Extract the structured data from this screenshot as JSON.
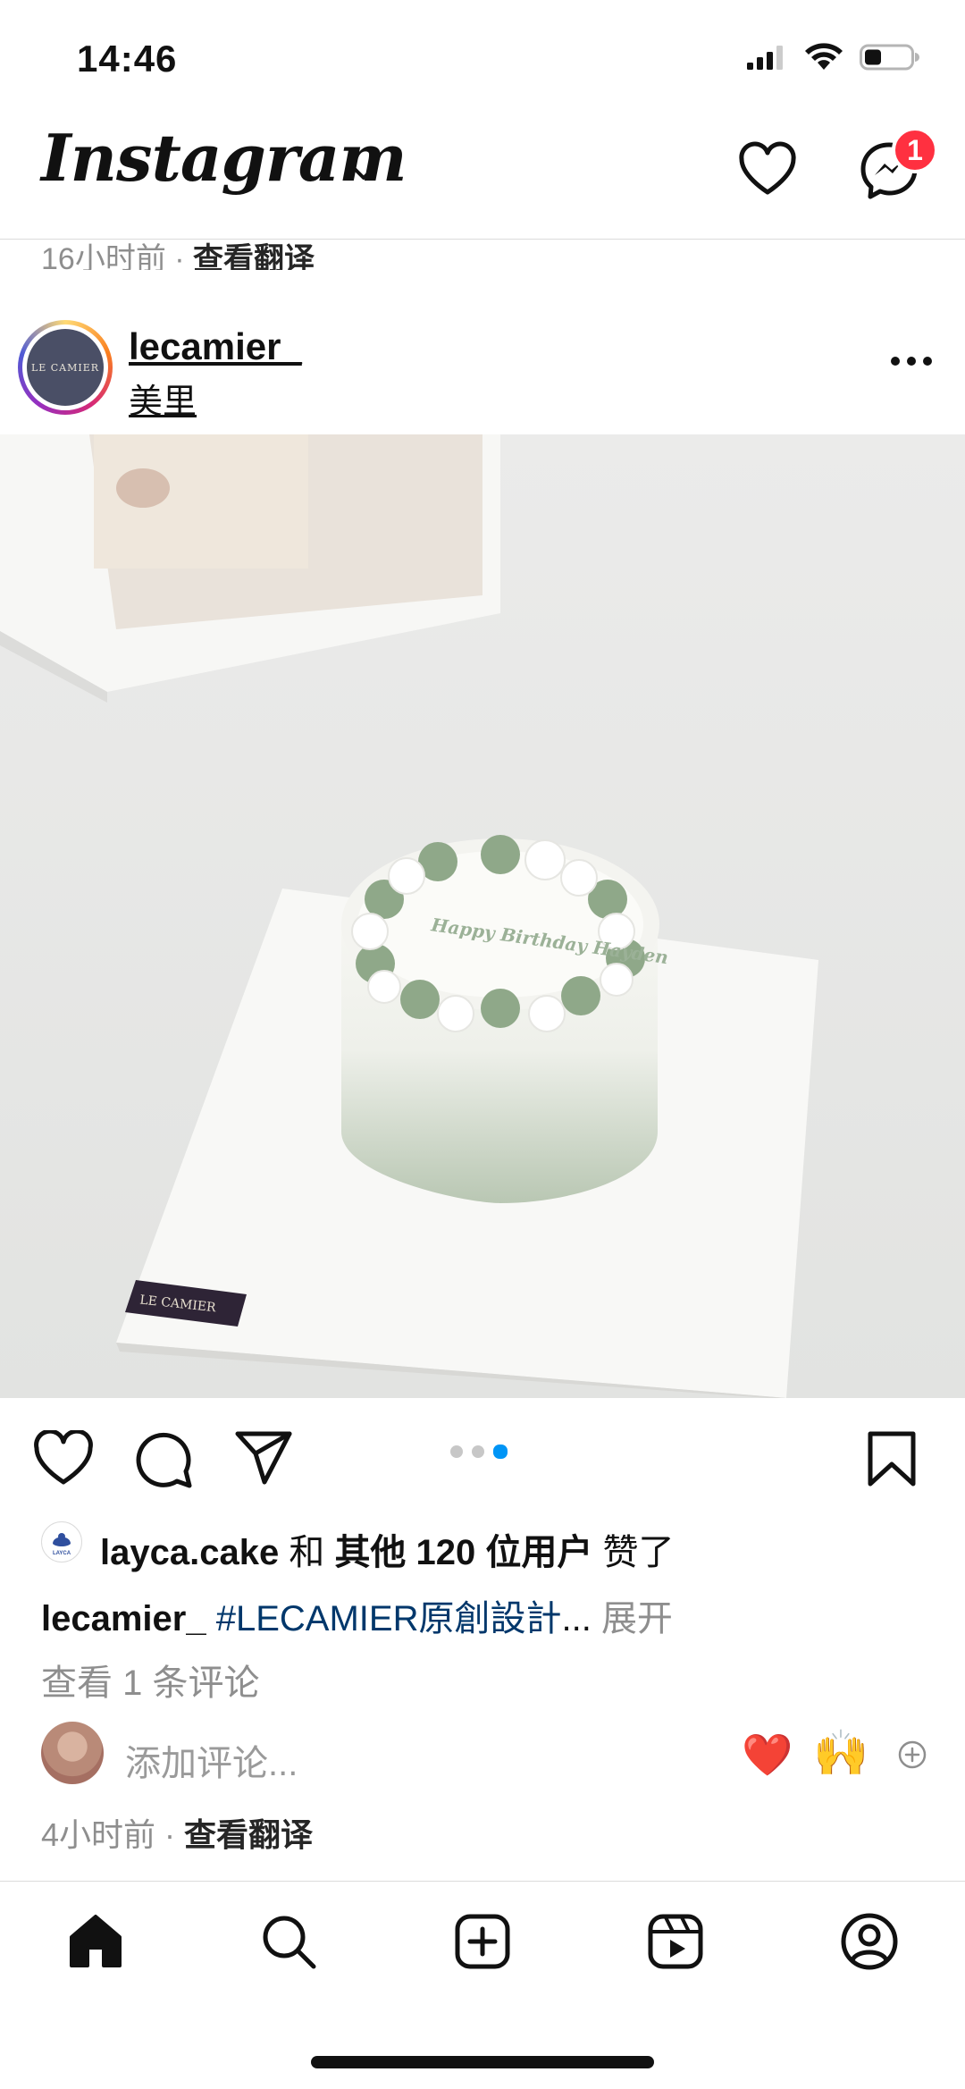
{
  "status_bar": {
    "time": "14:46",
    "icons": [
      "cellular-signal-icon",
      "wifi-icon",
      "battery-icon"
    ]
  },
  "top_nav": {
    "logo": "Instagram",
    "notification_badge": "1",
    "icons": [
      "chevron-down-icon",
      "heart-icon",
      "messenger-icon"
    ]
  },
  "previous_post": {
    "time_ago": "16小时前",
    "separator": " · ",
    "translate": "查看翻译"
  },
  "post": {
    "username": "lecamier_",
    "location": "美里",
    "avatar_text": "LE CAMIER",
    "image_brand_card": "LE CAMIER",
    "image_cake_text": "Happy Birthday Hayden",
    "carousel": {
      "count": 3,
      "active": 3
    },
    "likes": {
      "liker": "layca.cake",
      "connector": " 和 ",
      "others": "其他 120 位用户",
      "suffix": " 赞了",
      "liker_avatar_text": "LAYCA"
    },
    "caption": {
      "username": "lecamier_",
      "hashtag": "#LECAMIER原創設計",
      "ellipsis": "...",
      "expand": "展开"
    },
    "view_comments": "查看 1 条评论",
    "add_comment_placeholder": "添加评论...",
    "quick_emojis": [
      "❤️",
      "🙌"
    ],
    "time_ago": "4小时前",
    "separator": " · ",
    "translate": "查看翻译"
  },
  "tab_bar": {
    "tabs": [
      "home-icon",
      "search-icon",
      "create-icon",
      "reels-icon",
      "profile-icon"
    ]
  },
  "colors": {
    "accent_blue": "#0095f6",
    "badge_red": "#ff3040",
    "hashtag": "#00376b",
    "secondary_text": "#8e8e8e"
  }
}
